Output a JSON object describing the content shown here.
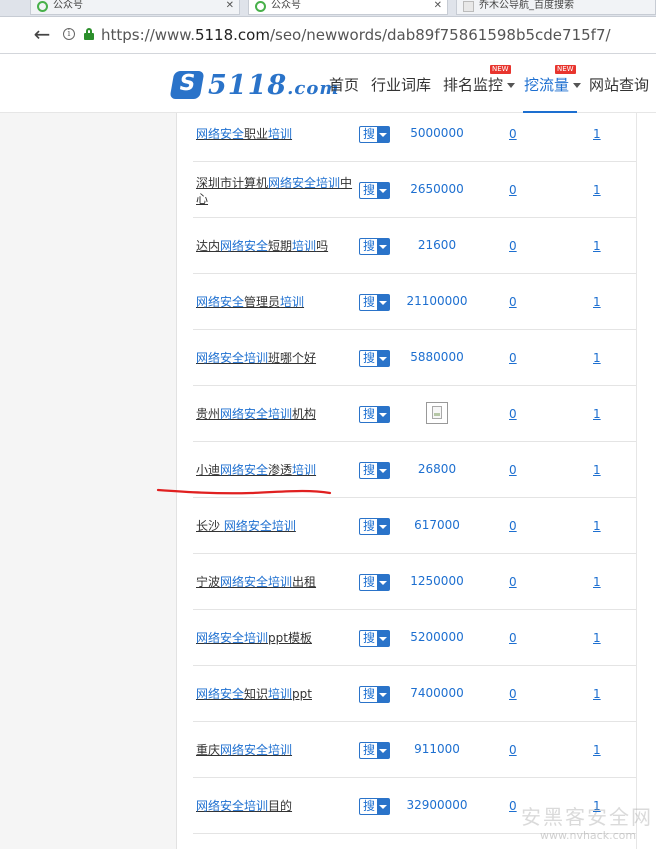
{
  "browser": {
    "tabs": [
      {
        "title": "公众号"
      },
      {
        "title": "公众号"
      },
      {
        "title": "乔木公导航_百度搜索"
      }
    ],
    "back_symbol": "←",
    "info_symbol": "i",
    "url": {
      "scheme": "https://www.",
      "domain": "5118.com",
      "path": "/seo/newwords/dab89f75861598b5cde715f7/"
    }
  },
  "site": {
    "logo": {
      "number": "5118",
      "suffix": ".com",
      "mark_letter": "S"
    },
    "nav": [
      {
        "label": "首页"
      },
      {
        "label": "行业词库"
      },
      {
        "label": "排名监控",
        "badge": "NEW"
      },
      {
        "label": "挖流量",
        "badge": "NEW"
      },
      {
        "label": "网站查询"
      }
    ],
    "brand_color": "#2a73c9",
    "link_color": "#1d6fd0",
    "badge_color": "#e8352e"
  },
  "table": {
    "search_label": "搜",
    "rows": [
      {
        "parts": [
          {
            "t": "网络安全",
            "h": true
          },
          {
            "t": "职业",
            "h": false
          },
          {
            "t": "培训",
            "h": true
          }
        ],
        "volume": "5000000",
        "col1": "0",
        "col2": "1"
      },
      {
        "parts": [
          {
            "t": "深圳市计算机",
            "h": false
          },
          {
            "t": "网络安全培训",
            "h": true
          },
          {
            "t": "中心",
            "h": false
          }
        ],
        "volume": "2650000",
        "col1": "0",
        "col2": "1"
      },
      {
        "parts": [
          {
            "t": "达内",
            "h": false
          },
          {
            "t": "网络安全",
            "h": true
          },
          {
            "t": "短期",
            "h": false
          },
          {
            "t": "培训",
            "h": true
          },
          {
            "t": "吗",
            "h": false
          }
        ],
        "volume": "21600",
        "col1": "0",
        "col2": "1"
      },
      {
        "parts": [
          {
            "t": "网络安全",
            "h": true
          },
          {
            "t": "管理员",
            "h": false
          },
          {
            "t": "培训",
            "h": true
          }
        ],
        "volume": "21100000",
        "col1": "0",
        "col2": "1"
      },
      {
        "parts": [
          {
            "t": "网络安全培训",
            "h": true
          },
          {
            "t": "班哪个好",
            "h": false
          }
        ],
        "volume": "5880000",
        "col1": "0",
        "col2": "1"
      },
      {
        "parts": [
          {
            "t": "贵州",
            "h": false
          },
          {
            "t": "网络安全培训",
            "h": true
          },
          {
            "t": "机构",
            "h": false
          }
        ],
        "volume": "",
        "broken_image": true,
        "col1": "0",
        "col2": "1"
      },
      {
        "parts": [
          {
            "t": "小迪",
            "h": false
          },
          {
            "t": "网络安全",
            "h": true
          },
          {
            "t": "渗透",
            "h": false
          },
          {
            "t": "培训",
            "h": true
          }
        ],
        "volume": "26800",
        "col1": "0",
        "col2": "1"
      },
      {
        "parts": [
          {
            "t": "长沙 ",
            "h": false
          },
          {
            "t": "网络安全培训",
            "h": true
          }
        ],
        "volume": "617000",
        "col1": "0",
        "col2": "1"
      },
      {
        "parts": [
          {
            "t": "宁波",
            "h": false
          },
          {
            "t": "网络安全培训",
            "h": true
          },
          {
            "t": "出租",
            "h": false
          }
        ],
        "volume": "1250000",
        "col1": "0",
        "col2": "1"
      },
      {
        "parts": [
          {
            "t": "网络安全培训",
            "h": true
          },
          {
            "t": "ppt模板",
            "h": false
          }
        ],
        "volume": "5200000",
        "col1": "0",
        "col2": "1"
      },
      {
        "parts": [
          {
            "t": "网络安全",
            "h": true
          },
          {
            "t": "知识",
            "h": false
          },
          {
            "t": "培训",
            "h": true
          },
          {
            "t": "ppt",
            "h": false
          }
        ],
        "volume": "7400000",
        "col1": "0",
        "col2": "1"
      },
      {
        "parts": [
          {
            "t": "重庆",
            "h": false
          },
          {
            "t": "网络安全培训",
            "h": true
          }
        ],
        "volume": "911000",
        "col1": "0",
        "col2": "1"
      },
      {
        "parts": [
          {
            "t": "网络安全培训",
            "h": true
          },
          {
            "t": "目的",
            "h": false
          }
        ],
        "volume": "32900000",
        "col1": "0",
        "col2": "1"
      }
    ]
  },
  "annotation": {
    "underline_color": "#e02020"
  },
  "watermark": {
    "text_cn": "安黑客安全网",
    "url": "www.nvhack.com"
  }
}
